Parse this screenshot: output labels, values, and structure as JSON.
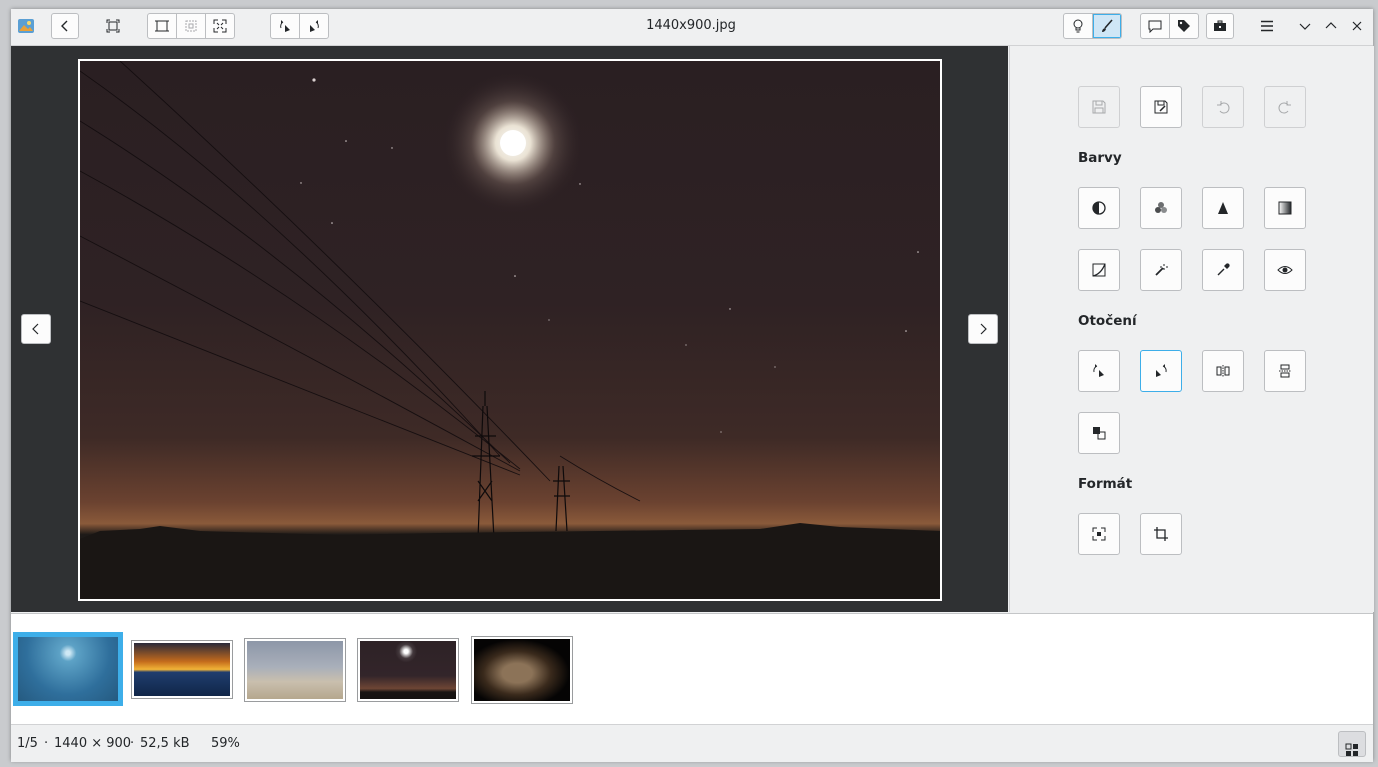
{
  "window": {
    "title": "1440x900.jpg"
  },
  "toolbar": {
    "back_icon": "chevron-left-icon",
    "fit_icon": "fit-window-icon",
    "zoom_group_icons": [
      "zoom-fit-icon",
      "zoom-original-icon",
      "zoom-fill-icon"
    ],
    "rotate_group_icons": [
      "rotate-left-icon",
      "rotate-right-icon"
    ],
    "right_icons": [
      "lightbulb-icon",
      "brush-icon",
      "comment-icon",
      "tag-icon",
      "toolbox-icon",
      "hamburger-menu-icon",
      "minimize-icon",
      "maximize-icon",
      "close-icon"
    ]
  },
  "viewer": {
    "prev_icon": "chevron-left-icon",
    "next_icon": "chevron-right-icon"
  },
  "panel": {
    "section_colors": "Barvy",
    "section_rotation": "Otočení",
    "section_format": "Formát",
    "top_buttons": [
      {
        "icon": "save-icon",
        "enabled": false
      },
      {
        "icon": "save-as-icon",
        "enabled": true
      },
      {
        "icon": "undo-icon",
        "enabled": false
      },
      {
        "icon": "redo-icon",
        "enabled": false
      }
    ],
    "color_buttons": [
      "brightness-contrast-icon",
      "color-balance-icon",
      "sharpen-icon",
      "desaturate-icon",
      "curves-icon",
      "auto-enhance-icon",
      "color-picker-icon",
      "red-eye-icon"
    ],
    "rotation_buttons": [
      "rotate-left-icon",
      "rotate-right-icon",
      "flip-horizontal-icon",
      "flip-vertical-icon",
      "transpose-icon"
    ],
    "format_buttons": [
      "resize-icon",
      "crop-icon"
    ]
  },
  "thumbnails": [
    {
      "name": "thumb-night-moon-blue",
      "colors": [
        "#2f6f9c",
        "#5da2c6"
      ],
      "selected": true
    },
    {
      "name": "thumb-sunset-sea",
      "colors": [
        "#e89a2a",
        "#1f3d6e"
      ],
      "selected": false
    },
    {
      "name": "thumb-horses",
      "colors": [
        "#8d97a8",
        "#c9bfae"
      ],
      "selected": false
    },
    {
      "name": "thumb-night-moon",
      "colors": [
        "#2d2226",
        "#6e4635"
      ],
      "selected": false
    },
    {
      "name": "thumb-wolf",
      "colors": [
        "#3a2a1c",
        "#8c7358"
      ],
      "selected": false
    }
  ],
  "status": {
    "position": "1/5",
    "dimensions": "1440 × 900",
    "filesize": "52,5 kB",
    "zoom": "59%",
    "separator": "·"
  }
}
